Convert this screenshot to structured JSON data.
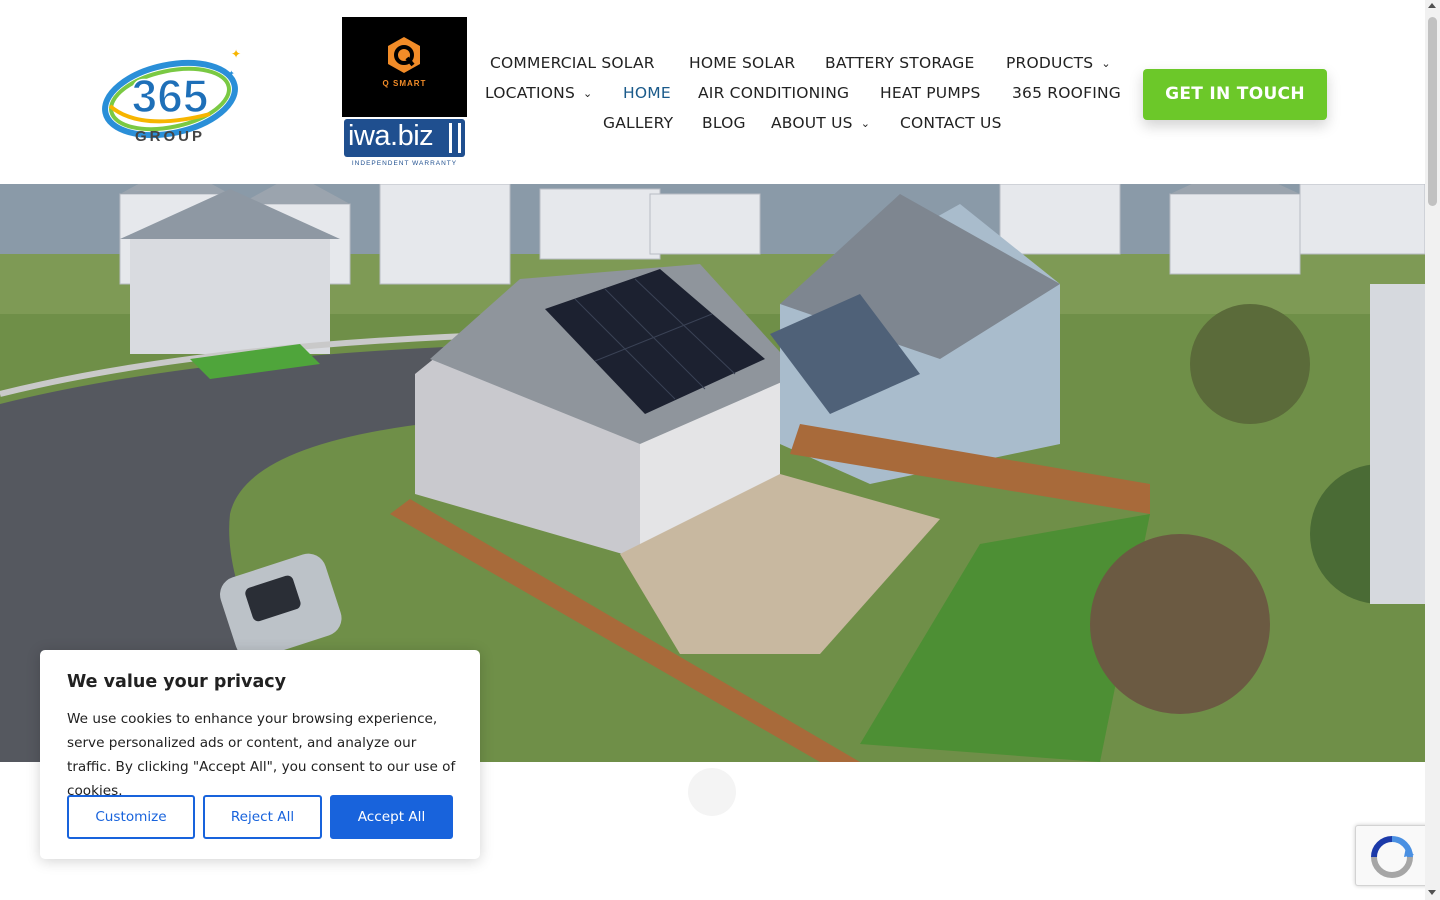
{
  "brand": {
    "logo_text": "365",
    "logo_sub": "GROUP",
    "partner1": "Q SMART",
    "partner2_main": "iwa.biz",
    "partner2_sub": "INDEPENDENT WARRANTY"
  },
  "nav": {
    "row1": [
      "COMMERCIAL SOLAR",
      "HOME SOLAR",
      "BATTERY STORAGE",
      "PRODUCTS"
    ],
    "row2": [
      "LOCATIONS",
      "HOME",
      "AIR CONDITIONING",
      "HEAT PUMPS",
      "365 ROOFING"
    ],
    "row3": [
      "GALLERY",
      "BLOG",
      "ABOUT US",
      "CONTACT US"
    ],
    "active": "HOME",
    "caret": "⌄"
  },
  "cta": {
    "label": "GET IN TOUCH"
  },
  "cookie": {
    "title": "We value your privacy",
    "text": "We use cookies to enhance your browsing experience, serve personalized ads or content, and analyze our traffic. By clicking \"Accept All\", you consent to our use of cookies.",
    "buttons": {
      "customize": "Customize",
      "reject": "Reject All",
      "accept": "Accept All"
    }
  },
  "colors": {
    "accent_green": "#6cc829",
    "cookie_blue": "#1863dc",
    "nav_active": "#1a5a8a",
    "nav_text": "#222222"
  },
  "icons": {
    "recaptcha": "recaptcha-icon",
    "scroll_up": "scroll-up-icon",
    "scroll_down": "scroll-down-icon"
  }
}
